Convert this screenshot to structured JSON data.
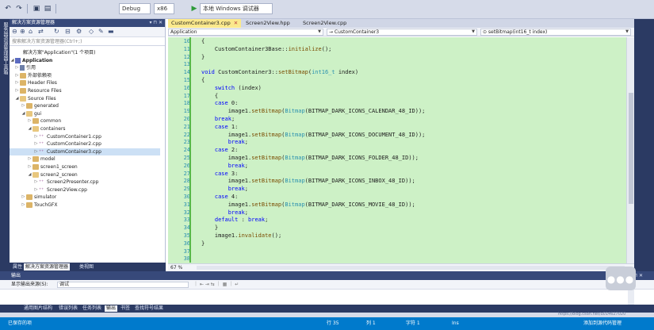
{
  "toolbar": {
    "config": "Debug",
    "platform": "x86",
    "run_target": "本地 Windows 调试器",
    "icons": [
      "undo-icon",
      "redo-icon",
      "save-icon",
      "save-all-icon",
      "play-icon"
    ]
  },
  "left_strip": {
    "labels": [
      "服务器资源管理器",
      "工具箱"
    ]
  },
  "solution_explorer": {
    "title": "解决方案资源管理器",
    "search_placeholder": "搜索解决方案资源管理器(Ctrl+;)",
    "items": [
      {
        "label": "解决方案\"Application\"(1 个项目)",
        "level": 0,
        "icon": "solution",
        "arrow": ""
      },
      {
        "label": "Application",
        "level": 0,
        "icon": "proj",
        "arrow": "◢",
        "bold": true
      },
      {
        "label": "引用",
        "level": 1,
        "icon": "ref",
        "arrow": "▷"
      },
      {
        "label": "外部依赖项",
        "level": 1,
        "icon": "folder",
        "arrow": "▷"
      },
      {
        "label": "Header Files",
        "level": 1,
        "icon": "folder",
        "arrow": "▷"
      },
      {
        "label": "Resource Files",
        "level": 1,
        "icon": "folder",
        "arrow": "▷"
      },
      {
        "label": "Source Files",
        "level": 1,
        "icon": "folder-open",
        "arrow": "◢"
      },
      {
        "label": "generated",
        "level": 2,
        "icon": "folder",
        "arrow": "▷"
      },
      {
        "label": "gui",
        "level": 2,
        "icon": "folder-open",
        "arrow": "◢"
      },
      {
        "label": "common",
        "level": 3,
        "icon": "folder",
        "arrow": "▷"
      },
      {
        "label": "containers",
        "level": 3,
        "icon": "folder-open",
        "arrow": "◢"
      },
      {
        "label": "CustomContainer1.cpp",
        "level": 4,
        "icon": "cpp",
        "arrow": "▷"
      },
      {
        "label": "CustomContainer2.cpp",
        "level": 4,
        "icon": "cpp",
        "arrow": "▷"
      },
      {
        "label": "CustomContainer3.cpp",
        "level": 4,
        "icon": "cpp",
        "arrow": "▷",
        "selected": true
      },
      {
        "label": "model",
        "level": 3,
        "icon": "folder",
        "arrow": "▷"
      },
      {
        "label": "screen1_screen",
        "level": 3,
        "icon": "folder",
        "arrow": "▷"
      },
      {
        "label": "screen2_screen",
        "level": 3,
        "icon": "folder-open",
        "arrow": "◢"
      },
      {
        "label": "Screen2Presenter.cpp",
        "level": 4,
        "icon": "cpp",
        "arrow": "▷"
      },
      {
        "label": "Screen2View.cpp",
        "level": 4,
        "icon": "cpp",
        "arrow": "▷"
      },
      {
        "label": "simulator",
        "level": 2,
        "icon": "folder",
        "arrow": "▷"
      },
      {
        "label": "TouchGFX",
        "level": 2,
        "icon": "folder",
        "arrow": "▷"
      }
    ],
    "tabs": [
      "属性",
      "解决方案资源管理器",
      "类视图"
    ]
  },
  "editor": {
    "tabs": [
      {
        "label": "CustomContainer3.cpp",
        "active": true
      },
      {
        "label": "Screen2View.hpp",
        "active": false
      },
      {
        "label": "Screen2View.cpp",
        "active": false
      }
    ],
    "nav": {
      "project": "Application",
      "scope": "→ CustomContainer3",
      "member": "⊙ setBitmap(int16_t index)"
    },
    "zoom": "67 %",
    "lines": [
      {
        "n": "10",
        "text": "{"
      },
      {
        "n": "11",
        "text": "    CustomContainer3Base::initialize();"
      },
      {
        "n": "12",
        "text": "}"
      },
      {
        "n": "13",
        "text": ""
      },
      {
        "n": "14",
        "text": "void CustomContainer3::setBitmap(int16_t index)"
      },
      {
        "n": "15",
        "text": "{"
      },
      {
        "n": "16",
        "text": "    switch (index)"
      },
      {
        "n": "17",
        "text": "    {"
      },
      {
        "n": "18",
        "text": "    case 0:"
      },
      {
        "n": "19",
        "text": "        image1.setBitmap(Bitmap(BITMAP_DARK_ICONS_CALENDAR_48_ID));"
      },
      {
        "n": "20",
        "text": "    break;"
      },
      {
        "n": "21",
        "text": "    case 1:"
      },
      {
        "n": "22",
        "text": "        image1.setBitmap(Bitmap(BITMAP_DARK_ICONS_DOCUMENT_48_ID));"
      },
      {
        "n": "23",
        "text": "        break;"
      },
      {
        "n": "24",
        "text": "    case 2:"
      },
      {
        "n": "25",
        "text": "        image1.setBitmap(Bitmap(BITMAP_DARK_ICONS_FOLDER_48_ID));"
      },
      {
        "n": "26",
        "text": "        break;"
      },
      {
        "n": "27",
        "text": "    case 3:"
      },
      {
        "n": "28",
        "text": "        image1.setBitmap(Bitmap(BITMAP_DARK_ICONS_INBOX_48_ID));"
      },
      {
        "n": "29",
        "text": "        break;"
      },
      {
        "n": "30",
        "text": "    case 4:"
      },
      {
        "n": "31",
        "text": "        image1.setBitmap(Bitmap(BITMAP_DARK_ICONS_MOVIE_48_ID));"
      },
      {
        "n": "32",
        "text": "        break;"
      },
      {
        "n": "33",
        "text": "    default : break;"
      },
      {
        "n": "34",
        "text": "    }"
      },
      {
        "n": "35",
        "text": "    image1.invalidate();"
      },
      {
        "n": "36",
        "text": "}"
      },
      {
        "n": "37",
        "text": ""
      },
      {
        "n": "38",
        "text": ""
      }
    ]
  },
  "output": {
    "title": "输出",
    "source_label": "显示输出来源(S):",
    "source_value": "调试",
    "bottom_tabs": [
      "通用图片结构",
      "错误列表",
      "任务列表",
      "输出",
      "书签",
      "查找符号结果"
    ]
  },
  "status": {
    "left": "已保存的项",
    "line": "行 35",
    "col": "列 1",
    "ch": "字符 1",
    "mode": "Ins",
    "right": "添加到源代码管理"
  },
  "watermark": "https://blog.csdn.net/u014627020",
  "colors": {
    "accent": "#007acc",
    "code_bg": "#cdf1c6",
    "active_tab": "#fbe98d",
    "panel_dark": "#2b3a63"
  }
}
